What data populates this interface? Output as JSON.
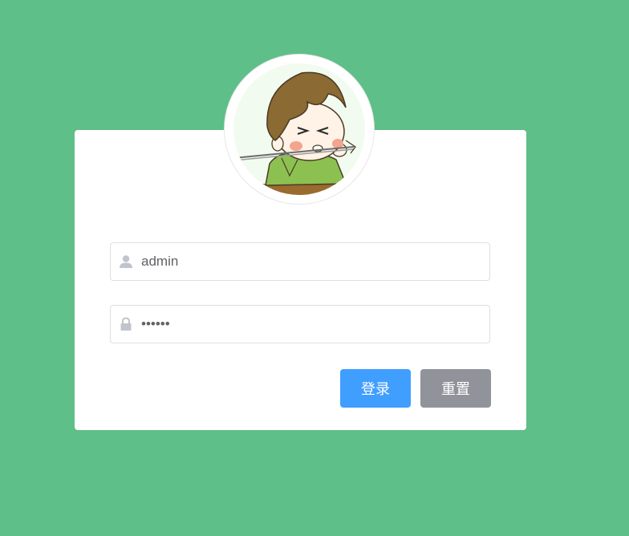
{
  "login_form": {
    "avatar_icon": "cartoon-boy-avatar",
    "username": {
      "value": "admin",
      "icon": "user-icon"
    },
    "password": {
      "value": "123456",
      "icon": "lock-icon"
    },
    "buttons": {
      "login_label": "登录",
      "reset_label": "重置"
    }
  },
  "colors": {
    "background": "#5ebf88",
    "card": "#ffffff",
    "primary": "#409eff",
    "info": "#909399",
    "input_border": "#dcdfe6",
    "icon": "#c0c4cc"
  }
}
